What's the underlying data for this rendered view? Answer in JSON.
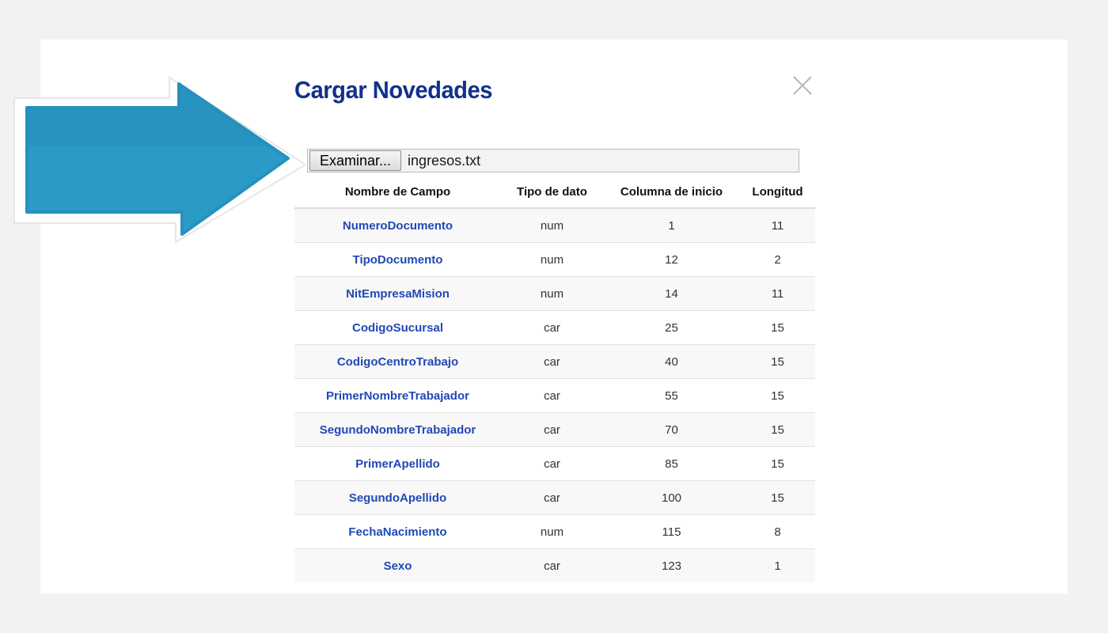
{
  "dialog": {
    "title": "Cargar Novedades",
    "close_icon": "close-icon"
  },
  "file_input": {
    "button_label": "Examinar...",
    "file_name": "ingresos.txt"
  },
  "annotation": {
    "icon": "arrow-right-icon",
    "color": "#2a9bc6"
  },
  "table": {
    "headers": [
      "Nombre de Campo",
      "Tipo de dato",
      "Columna de inicio",
      "Longitud"
    ],
    "rows": [
      [
        "NumeroDocumento",
        "num",
        "1",
        "11"
      ],
      [
        "TipoDocumento",
        "num",
        "12",
        "2"
      ],
      [
        "NitEmpresaMision",
        "num",
        "14",
        "11"
      ],
      [
        "CodigoSucursal",
        "car",
        "25",
        "15"
      ],
      [
        "CodigoCentroTrabajo",
        "car",
        "40",
        "15"
      ],
      [
        "PrimerNombreTrabajador",
        "car",
        "55",
        "15"
      ],
      [
        "SegundoNombreTrabajador",
        "car",
        "70",
        "15"
      ],
      [
        "PrimerApellido",
        "car",
        "85",
        "15"
      ],
      [
        "SegundoApellido",
        "car",
        "100",
        "15"
      ],
      [
        "FechaNacimiento",
        "num",
        "115",
        "8"
      ],
      [
        "Sexo",
        "car",
        "123",
        "1"
      ]
    ]
  }
}
